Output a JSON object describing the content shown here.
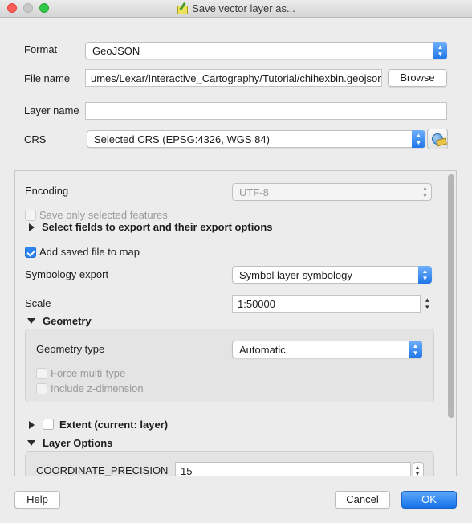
{
  "window": {
    "title": "Save vector layer as..."
  },
  "format": {
    "label": "Format",
    "value": "GeoJSON"
  },
  "file_name": {
    "label": "File name",
    "value": "umes/Lexar/Interactive_Cartography/Tutorial/chihexbin.geojson",
    "browse_label": "Browse"
  },
  "layer_name": {
    "label": "Layer name",
    "value": ""
  },
  "crs": {
    "label": "CRS",
    "value": "Selected CRS (EPSG:4326, WGS 84)"
  },
  "options": {
    "encoding": {
      "label": "Encoding",
      "value": "UTF-8"
    },
    "save_selected": {
      "label": "Save only selected features",
      "checked": false
    },
    "select_fields": {
      "label": "Select fields to export and their export options"
    },
    "add_to_map": {
      "label": "Add saved file to map",
      "checked": true
    },
    "symbology_export": {
      "label": "Symbology export",
      "value": "Symbol layer symbology"
    },
    "scale": {
      "label": "Scale",
      "value": "1:50000"
    },
    "geometry": {
      "header": "Geometry",
      "type_label": "Geometry type",
      "type_value": "Automatic",
      "force_multi": {
        "label": "Force multi-type",
        "checked": false
      },
      "include_z": {
        "label": "Include z-dimension",
        "checked": false
      }
    },
    "extent": {
      "label": "Extent (current: layer)",
      "checked": false
    },
    "layer_options": {
      "header": "Layer Options",
      "coordinate_precision": {
        "label": "COORDINATE_PRECISION",
        "value": "15"
      }
    }
  },
  "footer": {
    "help_label": "Help",
    "cancel_label": "Cancel",
    "ok_label": "OK"
  }
}
